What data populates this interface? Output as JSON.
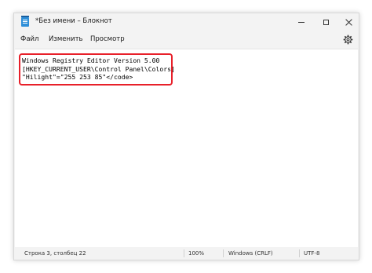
{
  "window": {
    "title": "*Без имени – Блокнот"
  },
  "menu": {
    "file": "Файл",
    "edit": "Изменить",
    "view": "Просмотр"
  },
  "editor": {
    "lines": [
      "Windows Registry Editor Version 5.00",
      "[HKEY_CURRENT_USER\\Control Panel\\Colors]",
      "\"Hilight\"=\"255 253 85\"</code>"
    ],
    "highlight_color": "#e8202a"
  },
  "status": {
    "position": "Строка 3, столбец 22",
    "zoom": "100%",
    "line_ending": "Windows (CRLF)",
    "encoding": "UTF-8"
  },
  "icons": {
    "app": "notepad-icon",
    "settings": "gear-icon"
  }
}
